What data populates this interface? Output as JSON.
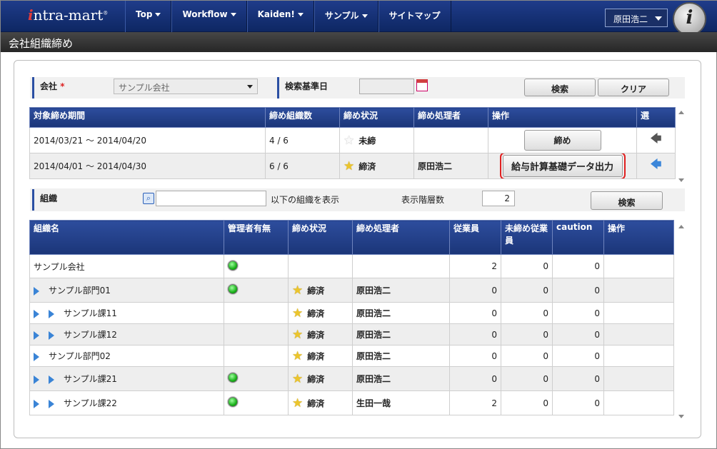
{
  "header": {
    "logo_text": "ntra-mart",
    "logo_i": "i",
    "logo_mark": "®",
    "nav": [
      {
        "label": "Top",
        "has_dropdown": true
      },
      {
        "label": "Workflow",
        "has_dropdown": true
      },
      {
        "label": "Kaiden!",
        "has_dropdown": true
      },
      {
        "label": "サンプル",
        "has_dropdown": true
      },
      {
        "label": "サイトマップ",
        "has_dropdown": false
      }
    ],
    "user": "原田浩二",
    "avatar_letter": "i"
  },
  "page_title": "会社組織締め",
  "search_form": {
    "company_label": "会社",
    "required_mark": "*",
    "company_value": "サンプル会社",
    "date_label": "検索基準日",
    "date_value": "",
    "search_button": "検索",
    "clear_button": "クリア"
  },
  "period_table": {
    "headers": [
      "対象締め期間",
      "締め組織数",
      "締め状況",
      "締め処理者",
      "操作",
      "選"
    ],
    "rows": [
      {
        "period": "2014/03/21 ～ 2014/04/20",
        "count": "4 / 6",
        "status": "未締",
        "status_star": "off",
        "operator": "",
        "action": "締め",
        "select_icon": "arrow-left-grey"
      },
      {
        "period": "2014/04/01 ～ 2014/04/30",
        "count": "6 / 6",
        "status": "締済",
        "status_star": "on",
        "operator": "原田浩二",
        "action": "給与計算基礎データ出力",
        "select_icon": "arrow-left-blue",
        "action_highlighted": true
      }
    ]
  },
  "org_filter": {
    "org_label": "組織",
    "org_value": "",
    "below_text": "以下の組織を表示",
    "depth_label": "表示階層数",
    "depth_value": "2",
    "search_button": "検索"
  },
  "org_table": {
    "headers": [
      "組織名",
      "管理者有無",
      "締め状況",
      "締め処理者",
      "従業員",
      "未締め従業員",
      "caution",
      "操作"
    ],
    "rows": [
      {
        "name": "サンプル会社",
        "level": 0,
        "manager": true,
        "status": "",
        "operator": "",
        "employees": "2",
        "unclosed": "0",
        "caution": "0"
      },
      {
        "name": "サンプル部門01",
        "level": 1,
        "manager": true,
        "status": "締済",
        "operator": "原田浩二",
        "employees": "0",
        "unclosed": "0",
        "caution": "0"
      },
      {
        "name": "サンプル課11",
        "level": 2,
        "manager": false,
        "status": "締済",
        "operator": "原田浩二",
        "employees": "0",
        "unclosed": "0",
        "caution": "0"
      },
      {
        "name": "サンプル課12",
        "level": 2,
        "manager": false,
        "status": "締済",
        "operator": "原田浩二",
        "employees": "0",
        "unclosed": "0",
        "caution": "0"
      },
      {
        "name": "サンプル部門02",
        "level": 1,
        "manager": false,
        "status": "締済",
        "operator": "原田浩二",
        "employees": "0",
        "unclosed": "0",
        "caution": "0"
      },
      {
        "name": "サンプル課21",
        "level": 2,
        "manager": true,
        "status": "締済",
        "operator": "原田浩二",
        "employees": "0",
        "unclosed": "0",
        "caution": "0"
      },
      {
        "name": "サンプル課22",
        "level": 2,
        "manager": true,
        "status": "締済",
        "operator": "生田一哉",
        "employees": "2",
        "unclosed": "0",
        "caution": "0"
      }
    ]
  },
  "colors": {
    "header_bg": "#1b3578",
    "highlight_border": "#e02020",
    "star_on": "#ecc52b",
    "manager_dot": "#19b019",
    "expand_arrow": "#3a84d6"
  }
}
